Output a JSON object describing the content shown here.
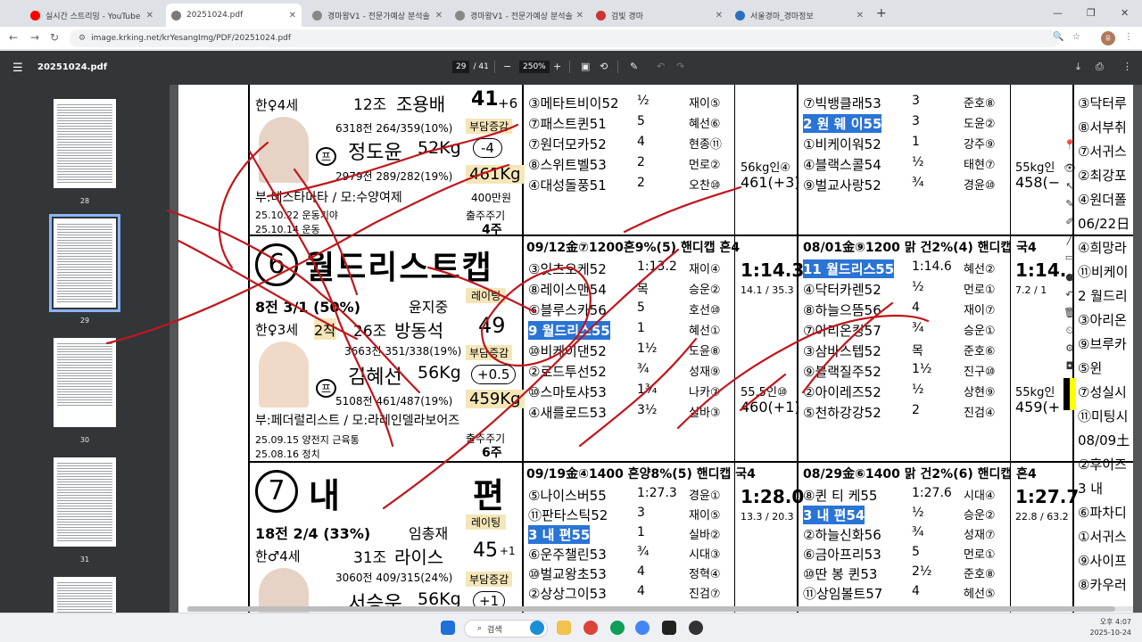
{
  "tabs": [
    {
      "label": "실시간 스트리밍 - YouTube St",
      "color": "#ff0000"
    },
    {
      "label": "20251024.pdf",
      "color": "#7a7a7a",
      "active": true
    },
    {
      "label": "경마왕V1 - 전문가예상 분석솔",
      "color": "#888888"
    },
    {
      "label": "경마왕V1 - 전문가예상 분석솔",
      "color": "#888888"
    },
    {
      "label": "검빛 경마",
      "color": "#cc3333"
    },
    {
      "label": "서울경마_경마정보",
      "color": "#2c6fbf"
    }
  ],
  "new_tab": "+",
  "address": {
    "url": "image.krking.net/krYesangImg/PDF/20251024.pdf"
  },
  "profile_initial": "유",
  "pdf_toolbar": {
    "filename": "20251024.pdf",
    "page_current": "29",
    "page_total": "/ 41",
    "zoom": "250%"
  },
  "sidebar": {
    "thumbs": [
      {
        "num": "28"
      },
      {
        "num": "29",
        "selected": true
      },
      {
        "num": "30"
      },
      {
        "num": "31"
      }
    ]
  },
  "page": {
    "left_top": {
      "line1": "한♀4세",
      "trainer_group": "12조",
      "trainer": "조용배",
      "rating": "41",
      "rating_adj": "+6",
      "stats1": "6318전 264/359(10%)",
      "weight_label": "부담증감",
      "jockey": "정도윤",
      "jockey_w": "52Kg",
      "weight_adj": "-4",
      "stats2": "2979전 289/282(19%)",
      "horse_w": "461Kg",
      "sire": "부:테스타마타 / 모:수양여제",
      "prize": "400만원",
      "note1": "25.10.22 운동기야",
      "note2": "25.10.14 운동",
      "next": "출주주기",
      "next_val": "4주"
    },
    "horse6": {
      "num": "6",
      "name": "월드리스트캡",
      "record": "8전 3/1 (50%)",
      "owner": "윤지중",
      "rating_label": "레이팅",
      "rating": "49",
      "sex": "한♀3세",
      "placing": "2착",
      "trainer_group": "26조",
      "trainer": "방동석",
      "weight_label": "부담증감",
      "stats1": "3663전 351/338(19%)",
      "jockey": "김혜선",
      "jockey_w": "56Kg",
      "weight_adj": "+0.5",
      "stats2": "5108전 461/487(19%)",
      "horse_w": "459Kg",
      "sire": "부:페더럴리스트 / 모:라레인델라보어즈",
      "note1": "25.09.15 양전지 근육통",
      "note2": "25.08.16 정치",
      "next": "출주주기",
      "next_val": "6주"
    },
    "horse7": {
      "num": "7",
      "name": "내",
      "name2": "편",
      "record": "18전 2/4 (33%)",
      "owner": "임총재",
      "rating_label": "레이팅",
      "rating": "45",
      "rating_adj": "+1",
      "sex": "한♂4세",
      "trainer_group": "31조",
      "trainer": "라이스",
      "weight_label": "부담증감",
      "stats1": "3060전 409/315(24%)",
      "jockey": "서승운",
      "jockey_w": "56Kg",
      "weight_adj": "+1"
    },
    "race_a_top": [
      {
        "t": "③메타트비이52",
        "d": "½",
        "j": "재이⑤"
      },
      {
        "t": "⑦패스트퀸51",
        "d": "5",
        "j": "혜선⑥"
      },
      {
        "t": "⑦원더모카52",
        "d": "4",
        "j": "현종⑪"
      },
      {
        "t": "⑧스위트벨53",
        "d": "2",
        "j": "먼로②"
      },
      {
        "t": "④대성돌풍51",
        "d": "2",
        "j": "오찬⑩"
      }
    ],
    "race_a_head": "09/12金⑦1200혼9%(5) 핸디캡 혼4",
    "race_a": [
      {
        "t": "③잇츠오케52",
        "d": "1:13.2",
        "j": "재이④"
      },
      {
        "t": "⑧레이스맨54",
        "d": "목",
        "j": "승운②"
      },
      {
        "t": "⑥블루스카56",
        "d": "5",
        "j": "호선⑩"
      },
      {
        "t": "9 월드리스55",
        "d": "1",
        "j": "혜선①",
        "hl": true
      },
      {
        "t": "⑩비케이댄52",
        "d": "1½",
        "j": "도윤⑧"
      },
      {
        "t": "②로드투선52",
        "d": "¾",
        "j": "성재⑨"
      },
      {
        "t": "⑩스마토샤53",
        "d": "1¾",
        "j": "나카⑦"
      },
      {
        "t": "④새를로드53",
        "d": "3½",
        "j": "실바③"
      }
    ],
    "race_a_time": "1:14.3",
    "race_a_split": "14.1 / 35.3",
    "race_b_head": "09/19金④1400 혼양8%(5) 핸디캡 국4",
    "race_b": [
      {
        "t": "⑤나이스버55",
        "d": "1:27.3",
        "j": "경윤①"
      },
      {
        "t": "⑪판타스틱52",
        "d": "3",
        "j": "재이⑤"
      },
      {
        "t": "3 내 편55",
        "d": "1",
        "j": "실바②",
        "hl": true
      },
      {
        "t": "⑥운주챌린53",
        "d": "¾",
        "j": "시대③"
      },
      {
        "t": "⑩벌교왕초53",
        "d": "4",
        "j": "정혁④"
      },
      {
        "t": "②상상그이53",
        "d": "4",
        "j": "진검⑦"
      }
    ],
    "race_b_time": "1:28.0",
    "race_b_split": "13.3 / 20.3",
    "race_c_top": [
      {
        "t": "⑦빅뱅클래53",
        "d": "3",
        "j": "준호⑧"
      },
      {
        "t": "2 원 웨 이55",
        "d": "3",
        "j": "도윤②",
        "hl": true
      },
      {
        "t": "①비케이워52",
        "d": "1",
        "j": "강주⑨"
      },
      {
        "t": "④블랙스콜54",
        "d": "½",
        "j": "태현⑦"
      },
      {
        "t": "⑨벌교사랑52",
        "d": "¾",
        "j": "경윤⑩"
      }
    ],
    "race_c_head": "08/01金⑨1200 맑 건2%(4) 핸디캡 국4",
    "race_c": [
      {
        "t": "11 월드리스55",
        "d": "1:14.6",
        "j": "혜선②",
        "hl": true
      },
      {
        "t": "④닥터카렌52",
        "d": "½",
        "j": "먼로①"
      },
      {
        "t": "⑧하늘으뜸56",
        "d": "4",
        "j": "재이⑦"
      },
      {
        "t": "⑦아리온킹57",
        "d": "¾",
        "j": "승운①"
      },
      {
        "t": "③삼바스텝52",
        "d": "목",
        "j": "준호⑥"
      },
      {
        "t": "⑨블랙질주52",
        "d": "1½",
        "j": "진구⑩"
      },
      {
        "t": "②아이레즈52",
        "d": "½",
        "j": "상현⑨"
      },
      {
        "t": "⑤천하강강52",
        "d": "2",
        "j": "진검④"
      }
    ],
    "race_c_time": "1:14.",
    "race_c_split": "7.2 / 1",
    "race_d_head": "08/29金⑥1400 맑 건2%(6) 핸디캡 혼4",
    "race_d": [
      {
        "t": "⑧퀸 티 케55",
        "d": "1:27.6",
        "j": "시대④"
      },
      {
        "t": "3 내 편54",
        "d": "½",
        "j": "승운②",
        "hl": true
      },
      {
        "t": "②하늘신화56",
        "d": "¾",
        "j": "성재⑦"
      },
      {
        "t": "⑥금아프리53",
        "d": "5",
        "j": "먼로①"
      },
      {
        "t": "⑩딴 봉 퀸53",
        "d": "2½",
        "j": "준호⑧"
      },
      {
        "t": "⑪상임볼트57",
        "d": "4",
        "j": "헤선⑤"
      }
    ],
    "race_d_time": "1:27.7",
    "race_d_split": "22.8 / 63.2",
    "far_right": [
      "③닥터루",
      "⑧서부취",
      "⑦서귀스",
      "②최강포",
      "④원더폴",
      "06/22日",
      "④희망라",
      "⑪비케이",
      "2 월드리",
      "③아리온",
      "⑨브루카",
      "⑤윈",
      "⑦성실시",
      "⑪미팅시",
      "08/09土",
      "②후이즈",
      "3 내",
      "⑥파차디",
      "①서귀스",
      "⑨사이프",
      "⑧카우러"
    ],
    "wt_a": "56kg인④",
    "wt_a2": "461(+3)",
    "wt_b": "55.5인⑩",
    "wt_b2": "460(+1)",
    "wt_c": "55kg인",
    "wt_c2": "458(−",
    "wt_d": "55kg인",
    "wt_d2": "459(+"
  },
  "taskbar": {
    "search": "검색",
    "time": "오후 4:07",
    "date": "2025-10-24"
  }
}
